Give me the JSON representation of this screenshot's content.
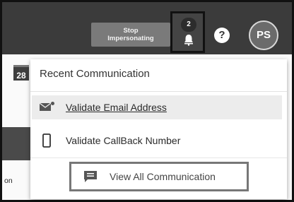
{
  "header": {
    "stop_impersonating": {
      "line1": "Stop",
      "line2": "Impersonating"
    },
    "notifications": {
      "count": "2",
      "icon": "bell-icon"
    },
    "help": {
      "icon": "help-icon",
      "glyph": "?"
    },
    "avatar": {
      "initials": "PS"
    }
  },
  "background": {
    "calendar_day": "28",
    "partial_text": "on"
  },
  "dropdown": {
    "title": "Recent Communication",
    "items": [
      {
        "label": "Validate Email Address",
        "icon": "email-icon"
      },
      {
        "label": "Validate CallBack Number",
        "icon": "phone-icon"
      }
    ],
    "view_all": {
      "label": "View All Communication",
      "icon": "message-icon"
    }
  },
  "colors": {
    "topbar": "#3b3b3b",
    "button": "#7a7a7a",
    "highlight_row": "#ececec"
  }
}
